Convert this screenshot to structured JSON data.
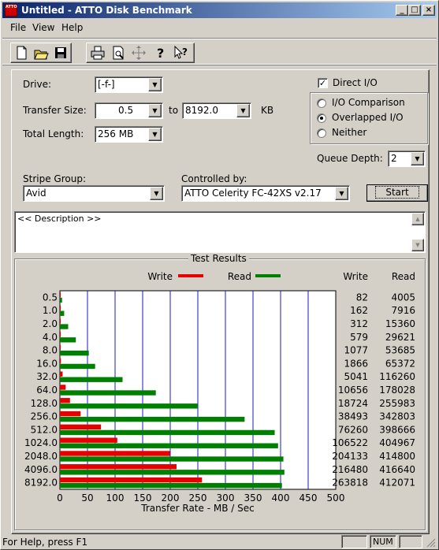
{
  "window": {
    "title": "Untitled - ATTO Disk Benchmark",
    "app_icon_text": "ATTO",
    "minimize": "_",
    "maximize": "□",
    "close": "×"
  },
  "menu": [
    "File",
    "View",
    "Help"
  ],
  "toolbar": {
    "new_icon": "new-document-icon",
    "open_icon": "open-folder-icon",
    "save_icon": "save-disk-icon",
    "print_icon": "printer-icon",
    "preview_icon": "print-preview-icon",
    "move_icon": "move-arrows-icon",
    "help_icon": "question-mark-icon",
    "context_help_icon": "context-help-icon"
  },
  "form": {
    "drive_label": "Drive:",
    "drive_value": "[-f-]",
    "transfer_size_label": "Transfer Size:",
    "transfer_from": "0.5",
    "to_label": "to",
    "transfer_to": "8192.0",
    "kb_label": "KB",
    "total_length_label": "Total Length:",
    "total_length_value": "256 MB",
    "direct_io_label": "Direct I/O",
    "direct_io_checked": true,
    "io_comparison_label": "I/O Comparison",
    "overlapped_io_label": "Overlapped I/O",
    "neither_label": "Neither",
    "selected_mode": "Overlapped I/O",
    "queue_depth_label": "Queue Depth:",
    "queue_depth_value": "2",
    "stripe_group_label": "Stripe Group:",
    "stripe_group_value": "Avid",
    "controlled_by_label": "Controlled by:",
    "controlled_by_value": "ATTO Celerity FC-42XS  v2.17",
    "start_button": "Start",
    "description": "<< Description >>"
  },
  "results": {
    "title": "Test Results",
    "legend_write": "Write",
    "legend_read": "Read",
    "col_write": "Write",
    "col_read": "Read",
    "xlabel": "Transfer Rate - MB / Sec"
  },
  "chart_data": {
    "type": "bar",
    "orientation": "horizontal",
    "title": "Test Results",
    "xlabel": "Transfer Rate - MB / Sec",
    "xlim": [
      0,
      500
    ],
    "xticks": [
      "0",
      "50",
      "100",
      "150",
      "200",
      "250",
      "300",
      "350",
      "400",
      "450",
      "500"
    ],
    "categories": [
      "0.5",
      "1.0",
      "2.0",
      "4.0",
      "8.0",
      "16.0",
      "32.0",
      "64.0",
      "128.0",
      "256.0",
      "512.0",
      "1024.0",
      "2048.0",
      "4096.0",
      "8192.0"
    ],
    "series": [
      {
        "name": "Write",
        "color": "#e60000",
        "values": [
          0.08,
          0.16,
          0.3,
          0.57,
          1.05,
          1.82,
          4.92,
          10.41,
          18.29,
          37.59,
          74.47,
          104.06,
          199.35,
          211.41,
          257.63
        ],
        "labels": [
          "82",
          "162",
          "312",
          "579",
          "1077",
          "1866",
          "5041",
          "10656",
          "18724",
          "38493",
          "76260",
          "106522",
          "204133",
          "216480",
          "263818"
        ]
      },
      {
        "name": "Read",
        "color": "#008000",
        "values": [
          3.91,
          7.73,
          15.0,
          28.93,
          52.43,
          63.84,
          113.54,
          173.86,
          249.98,
          334.77,
          389.32,
          395.48,
          405.08,
          406.88,
          402.41
        ],
        "labels": [
          "4005",
          "7916",
          "15360",
          "29621",
          "53685",
          "65372",
          "116260",
          "178028",
          "255983",
          "342803",
          "398666",
          "404967",
          "414800",
          "416640",
          "412071"
        ]
      }
    ],
    "grid": true,
    "legend": "top-center"
  },
  "status": {
    "text": "For Help, press F1",
    "num": "NUM"
  }
}
